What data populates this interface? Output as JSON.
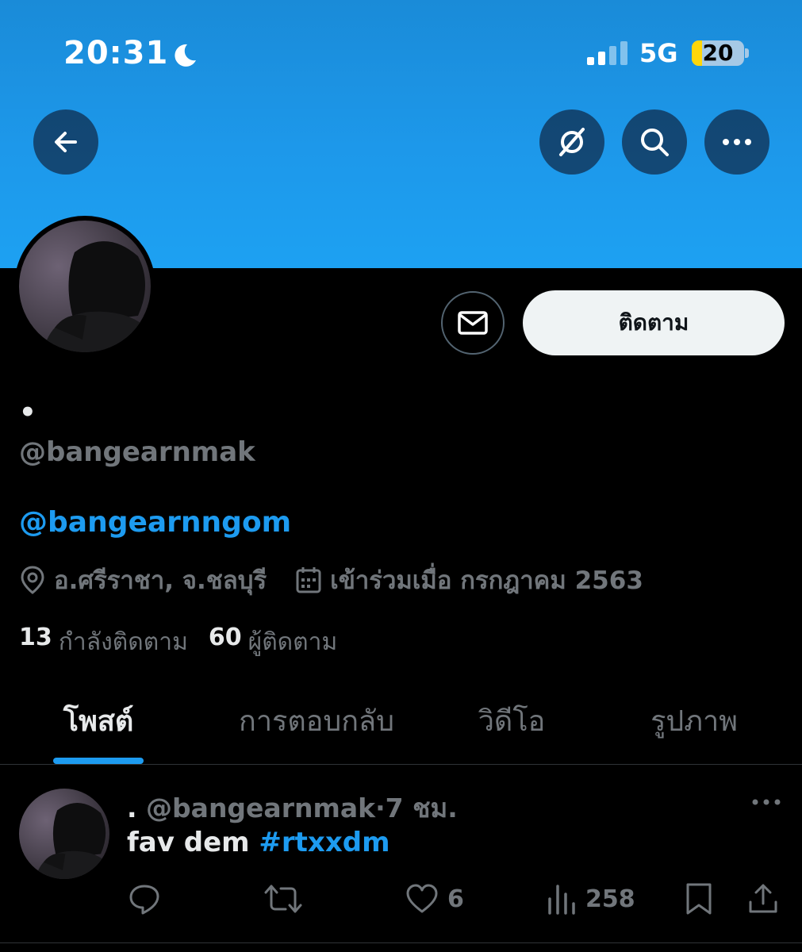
{
  "status_bar": {
    "time": "20:31",
    "network": "5G",
    "battery_percent": "20",
    "battery_level": 0.2,
    "signal_bars_active": 2
  },
  "header": {
    "icons": [
      "back-arrow-icon",
      "grok-icon",
      "search-icon",
      "more-icon"
    ]
  },
  "profile": {
    "display_name": "•",
    "handle": "@bangearnmak",
    "bio_link": "@bangearnngom",
    "location": "อ.ศรีราชา, จ.ชลบุรี",
    "joined": "เข้าร่วมเมื่อ กรกฎาคม 2563",
    "following_count": "13",
    "following_label": "กำลังติดตาม",
    "followers_count": "60",
    "followers_label": "ผู้ติดตาม",
    "follow_button_label": "ติดตาม"
  },
  "tabs": [
    {
      "label": "โพสต์",
      "active": true
    },
    {
      "label": "การตอบกลับ",
      "active": false
    },
    {
      "label": "วิดีโอ",
      "active": false
    },
    {
      "label": "รูปภาพ",
      "active": false
    }
  ],
  "post": {
    "display_name": ".",
    "handle": "@bangearnmak",
    "separator": "·",
    "time_ago": "7 ชม.",
    "text": "fav dem",
    "hashtag": "#rtxxdm",
    "likes": "6",
    "views": "258"
  },
  "colors": {
    "accent": "#1d9bf0",
    "banner": "#1da1f2",
    "background": "#000000",
    "muted": "#71767b"
  }
}
